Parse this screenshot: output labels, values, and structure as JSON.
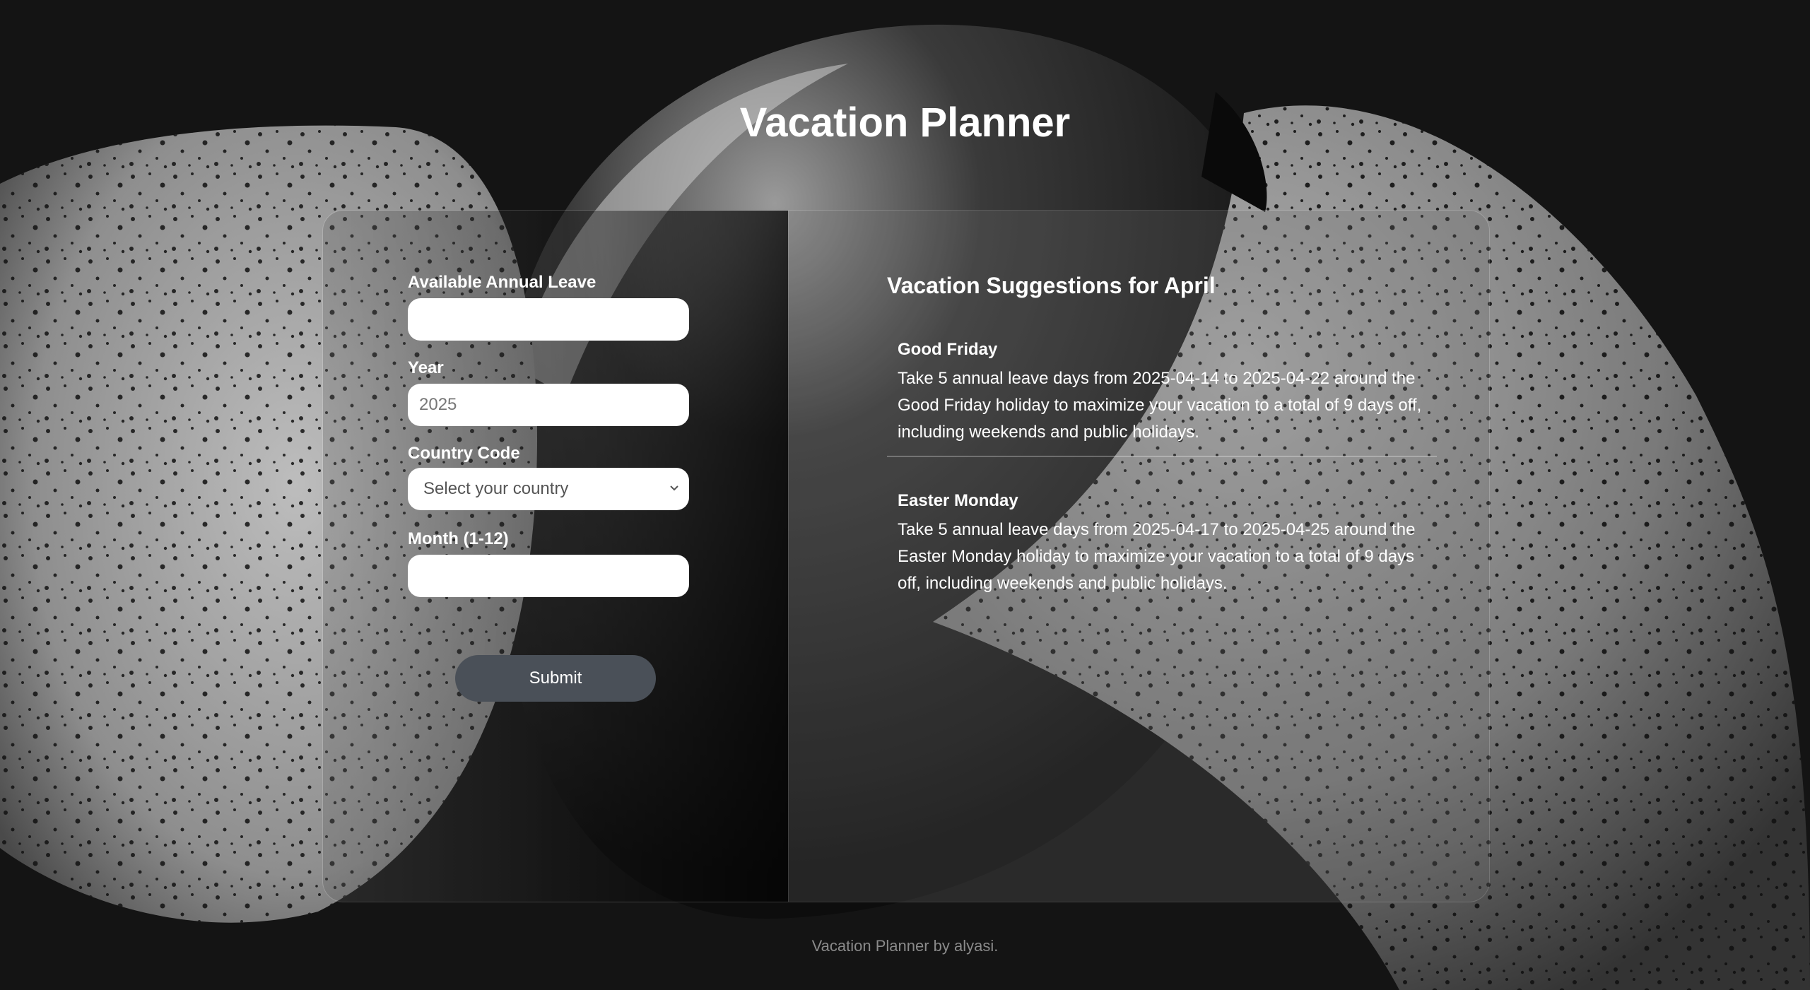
{
  "header": {
    "title": "Vacation Planner"
  },
  "form": {
    "annual_leave": {
      "label": "Available Annual Leave",
      "value": "",
      "placeholder": ""
    },
    "year": {
      "label": "Year",
      "value": "",
      "placeholder": "2025"
    },
    "country": {
      "label": "Country Code",
      "selected": "Select your country"
    },
    "month": {
      "label": "Month (1-12)",
      "value": "",
      "placeholder": ""
    },
    "submit_label": "Submit"
  },
  "results": {
    "title": "Vacation Suggestions for April",
    "suggestions": [
      {
        "holiday": "Good Friday",
        "text": "Take 5 annual leave days from 2025-04-14 to 2025-04-22 around the Good Friday holiday to maximize your vacation to a total of 9 days off, including weekends and public holidays."
      },
      {
        "holiday": "Easter Monday",
        "text": "Take 5 annual leave days from 2025-04-17 to 2025-04-25 around the Easter Monday holiday to maximize your vacation to a total of 9 days off, including weekends and public holidays."
      }
    ]
  },
  "footer": {
    "text": "Vacation Planner by alyasi."
  },
  "colors": {
    "background": "#141414",
    "button": "#4a5058",
    "text": "#ffffff"
  },
  "icons": {
    "select_arrow": "chevron-down-icon"
  }
}
